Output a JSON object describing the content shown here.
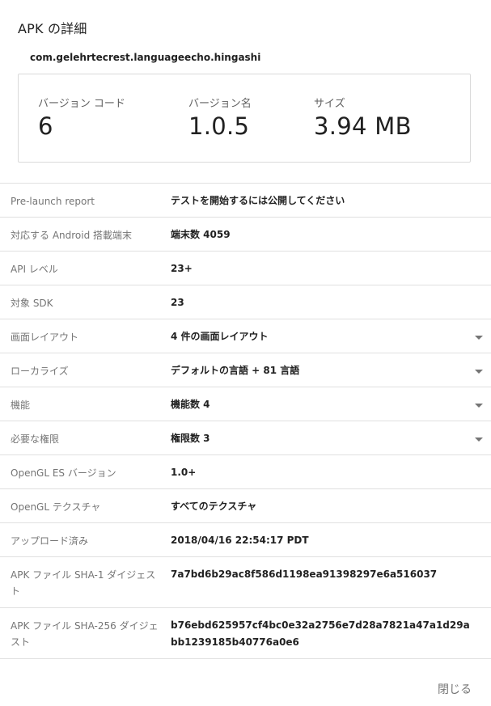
{
  "dialog": {
    "title": "APK の詳細",
    "package_name": "com.gelehrtecrest.languageecho.hingashi",
    "close_label": "閉じる"
  },
  "summary": {
    "version_code": {
      "label": "バージョン コード",
      "value": "6"
    },
    "version_name": {
      "label": "バージョン名",
      "value": "1.0.5"
    },
    "size": {
      "label": "サイズ",
      "value": "3.94 MB"
    }
  },
  "details": [
    {
      "label": "Pre-launch report",
      "value": "テストを開始するには公開してください",
      "expandable": false
    },
    {
      "label": "対応する Android 搭載端末",
      "value": "端末数 4059",
      "expandable": false
    },
    {
      "label": "API レベル",
      "value": "23+",
      "expandable": false
    },
    {
      "label": "対象 SDK",
      "value": "23",
      "expandable": false
    },
    {
      "label": "画面レイアウト",
      "value": "4 件の画面レイアウト",
      "expandable": true
    },
    {
      "label": "ローカライズ",
      "value": "デフォルトの言語 + 81 言語",
      "expandable": true
    },
    {
      "label": "機能",
      "value": "機能数 4",
      "expandable": true
    },
    {
      "label": "必要な権限",
      "value": "権限数 3",
      "expandable": true
    },
    {
      "label": "OpenGL ES バージョン",
      "value": "1.0+",
      "expandable": false
    },
    {
      "label": "OpenGL テクスチャ",
      "value": "すべてのテクスチャ",
      "expandable": false
    },
    {
      "label": "アップロード済み",
      "value": "2018/04/16 22:54:17 PDT",
      "expandable": false
    },
    {
      "label": "APK ファイル SHA-1 ダイジェスト",
      "value": "7a7bd6b29ac8f586d1198ea91398297e6a516037",
      "expandable": false
    },
    {
      "label": "APK ファイル SHA-256 ダイジェスト",
      "value": "b76ebd625957cf4bc0e32a2756e7d28a7821a47a1d29abb1239185b40776a0e6",
      "expandable": false
    }
  ]
}
